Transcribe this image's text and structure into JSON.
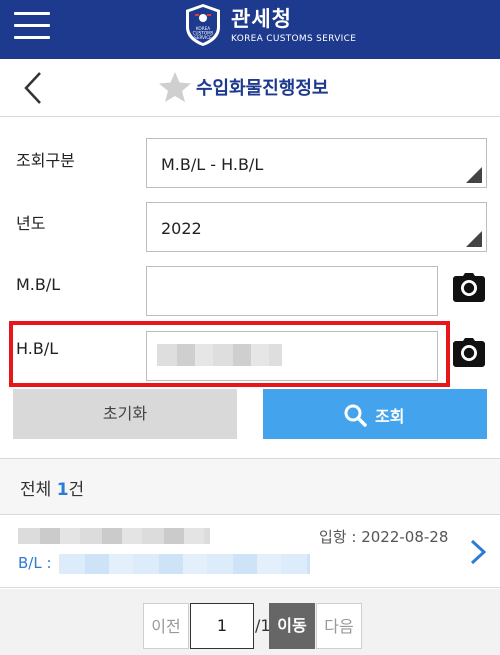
{
  "header": {
    "logo_title": "관세청",
    "logo_subtitle": "KOREA CUSTOMS SERVICE",
    "emblem_text": "KOREA CUSTOMS SERVICE",
    "brand_color": "#1d3a8e"
  },
  "titlebar": {
    "title": "수입화물진행정보"
  },
  "form": {
    "query_type": {
      "label": "조회구분",
      "value": "M.B/L - H.B/L"
    },
    "year": {
      "label": "년도",
      "value": "2022"
    },
    "mbl": {
      "label": "M.B/L",
      "value": ""
    },
    "hbl": {
      "label": "H.B/L",
      "value": ""
    }
  },
  "buttons": {
    "reset": "초기화",
    "search": "조회",
    "search_color": "#43a3ec"
  },
  "results": {
    "total_prefix": "전체 ",
    "total_count": "1",
    "total_suffix": "건",
    "items": [
      {
        "arrival": "입항 : 2022-08-28",
        "bl_label": "B/L :"
      }
    ]
  },
  "pager": {
    "prev": "이전",
    "current": "1",
    "total": "/1",
    "go": "이동",
    "next": "다음"
  },
  "icons": [
    "menu-icon",
    "back-icon",
    "star-icon",
    "camera-icon",
    "search-icon",
    "chevron-right-icon"
  ],
  "highlight_color": "#e8151b"
}
